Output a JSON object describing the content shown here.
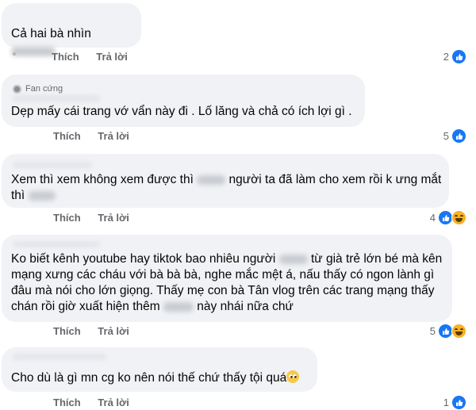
{
  "comments": [
    {
      "text_before": "Cả hai bà nhìn",
      "text_after": "",
      "actions": {
        "like": "Thích",
        "reply": "Trả lời"
      },
      "reaction_count": "2",
      "reactions": [
        "like-icon"
      ]
    },
    {
      "badge": "Fan cứng",
      "text": "Dẹp mấy cái trang vớ vẩn này đi . Lố lăng và chả có ích lợi gì .",
      "actions": {
        "like": "Thích",
        "reply": "Trả lời"
      },
      "reaction_count": "5",
      "reactions": [
        "like-icon"
      ]
    },
    {
      "text_line1_a": "Xem thì xem không xem được thì",
      "text_line1_b": "người ta đã làm cho xem rồi k ưng mắt",
      "text_line2": "thì",
      "actions": {
        "like": "Thích",
        "reply": "Trả lời"
      },
      "reaction_count": "4",
      "reactions": [
        "like-icon",
        "haha-icon"
      ]
    },
    {
      "line1_a": "Ko biết kênh youtube hay tiktok bao nhiêu người",
      "line1_b": "từ già trẻ lớn bé mà kên",
      "line2": "mạng xưng các cháu với bà bà bà, nghe mắc mệt á, nấu thấy có ngon lành gì",
      "line3": "đâu mà nói cho lớn giọng. Thấy mẹ con bà Tân vlog trên các trang mạng thấy",
      "line4_a": "chán rồi giờ xuất hiện thêm",
      "line4_b": "này nhái nữa chứ",
      "actions": {
        "like": "Thích",
        "reply": "Trả lời"
      },
      "reaction_count": "5",
      "reactions": [
        "like-icon",
        "haha-icon"
      ]
    },
    {
      "text": "Cho dù là gì mn cg ko nên nói thế chứ thấy tội quá",
      "emoji": "pleading-face-icon",
      "actions": {
        "like": "Thích",
        "reply": "Trả lời"
      },
      "reaction_count": "1",
      "reactions": [
        "like-icon"
      ]
    }
  ],
  "colors": {
    "bubble": "#f0f2f5",
    "action_text": "#65676b",
    "like_blue": "#1877f2",
    "haha_yellow": "#f7b125"
  }
}
